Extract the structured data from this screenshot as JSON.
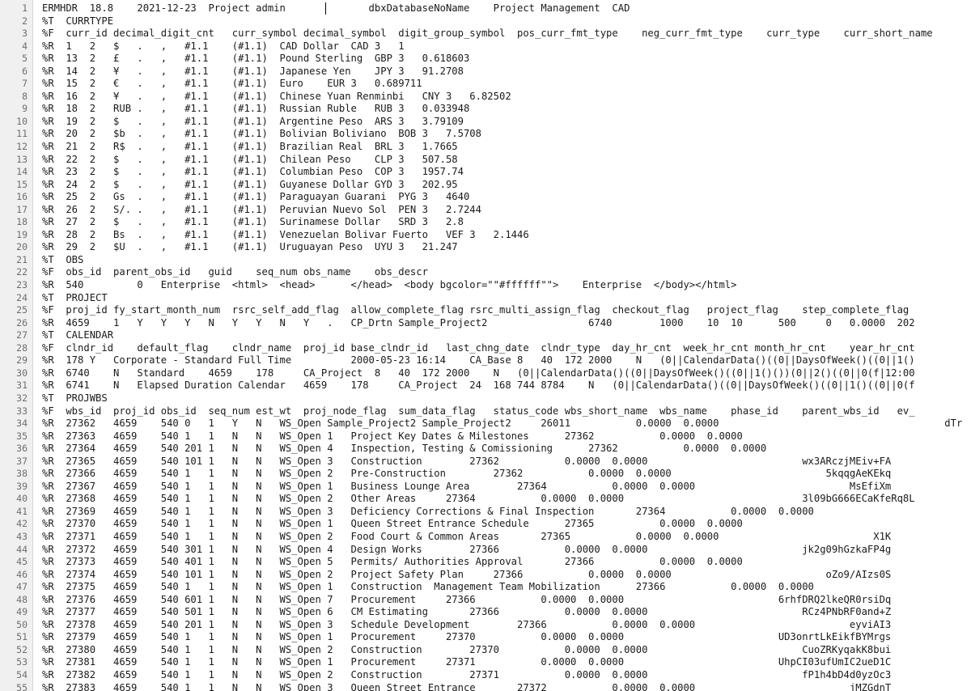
{
  "editor": {
    "lines": [
      "ERMHDR  18.8    2021-12-23  Project admin              dbxDatabaseNoName    Project Management  CAD",
      "%T  CURRTYPE",
      "%F  curr_id decimal_digit_cnt   curr_symbol decimal_symbol  digit_group_symbol  pos_curr_fmt_type    neg_curr_fmt_type    curr_type    curr_short_name",
      "%R  1   2   $   .   ,   #1.1    (#1.1)  CAD Dollar  CAD 3   1",
      "%R  13  2   £   .   ,   #1.1    (#1.1)  Pound Sterling  GBP 3   0.618603",
      "%R  14  2   ¥   .   ,   #1.1    (#1.1)  Japanese Yen    JPY 3   91.2708",
      "%R  15  2   €   .   ,   #1.1    (#1.1)  Euro    EUR 3   0.689711",
      "%R  16  2   ¥   .   ,   #1.1    (#1.1)  Chinese Yuan Renminbi   CNY 3   6.82502",
      "%R  18  2   RUB .   ,   #1.1    (#1.1)  Russian Ruble   RUB 3   0.033948",
      "%R  19  2   $   .   ,   #1.1    (#1.1)  Argentine Peso  ARS 3   3.79109",
      "%R  20  2   $b  .   ,   #1.1    (#1.1)  Bolivian Boliviano  BOB 3   7.5708",
      "%R  21  2   R$  .   ,   #1.1    (#1.1)  Brazilian Real  BRL 3   1.7665",
      "%R  22  2   $   .   ,   #1.1    (#1.1)  Chilean Peso    CLP 3   507.58",
      "%R  23  2   $   .   ,   #1.1    (#1.1)  Columbian Peso  COP 3   1957.74",
      "%R  24  2   $   .   ,   #1.1    (#1.1)  Guyanese Dollar GYD 3   202.95",
      "%R  25  2   Gs  .   ,   #1.1    (#1.1)  Paraguayan Guarani  PYG 3   4640",
      "%R  26  2   S/. .   ,   #1.1    (#1.1)  Peruvian Nuevo Sol  PEN 3   2.7244",
      "%R  27  2   $   .   ,   #1.1    (#1.1)  Surinamese Dollar   SRD 3   2.8",
      "%R  28  2   Bs  .   ,   #1.1    (#1.1)  Venezuelan Bolivar Fuerto   VEF 3   2.1446",
      "%R  29  2   $U  .   ,   #1.1    (#1.1)  Uruguayan Peso  UYU 3   21.247",
      "%T  OBS",
      "%F  obs_id  parent_obs_id   guid    seq_num obs_name    obs_descr",
      "%R  540         0   Enterprise  <html>\u0001\u0001  <head>\u0001\u0001    \u0001\u0001  </head>\u0001\u0001\u0001\u0001  <body bgcolor=\"\"#ffffff\"\">\u0001\u0001    Enterprise\u0001\u0001  </body>\u0001\u0001\u0001\u0001</html>",
      "%T  PROJECT",
      "%F  proj_id fy_start_month_num  rsrc_self_add_flag  allow_complete_flag rsrc_multi_assign_flag  checkout_flag   project_flag    step_complete_flag",
      "%R  4659    1   Y   Y   Y   N   Y   Y   N   Y   .   CP_Drtn Sample_Project2                 6740        1000    10  10      500     0   0.0000  202",
      "%T  CALENDAR",
      "%F  clndr_id    default_flag    clndr_name  proj_id base_clndr_id   last_chng_date  clndr_type  day_hr_cnt  week_hr_cnt month_hr_cnt    year_hr_cnt",
      "%R  178 Y   Corporate - Standard Full Time          2000-05-23 16:14    CA_Base 8   40  172 2000    N   (0||CalendarData()((0||DaysOfWeek()((0||1()",
      "%R  6740    N   Standard    4659    178     CA_Project  8   40  172 2000    N   (0||CalendarData()((0||DaysOfWeek()((0||1()())(0||2()((0||0(f|12:00",
      "%R  6741    N   Elapsed Duration Calendar   4659    178     CA_Project  24  168 744 8784    N   (0||CalendarData()((0||DaysOfWeek()((0||1()((0||0(f",
      "%T  PROJWBS",
      "%F  wbs_id  proj_id obs_id  seq_num est_wt  proj_node_flag  sum_data_flag   status_code wbs_short_name  wbs_name    phase_id    parent_wbs_id   ev_",
      "%R  27362   4659    540 0   1   Y   N   WS_Open Sample_Project2 Sample_Project2     26011           0.0000  0.0000                                      dTr",
      "%R  27363   4659    540 1   1   N   N   WS_Open 1   Project Key Dates & Milestones      27362           0.0000  0.0000",
      "%R  27364   4659    540 201 1   N   N   WS_Open 4   Inspection, Testing & Comissioning      27362           0.0000  0.0000",
      "%R  27365   4659    540 101 1   N   N   WS_Open 3   Construction        27362           0.0000  0.0000                          wx3ARczjMEiv+FA",
      "%R  27366   4659    540 1   1   N   N   WS_Open 2   Pre-Construction        27362           0.0000  0.0000                          5kqqgAeKEkq",
      "%R  27367   4659    540 1   1   N   N   WS_Open 1   Business Lounge Area        27364           0.0000  0.0000                          MsEfiXm",
      "%R  27368   4659    540 1   1   N   N   WS_Open 2   Other Areas     27364           0.0000  0.0000                              3l09bG666ECaKfeRq8L",
      "%R  27369   4659    540 1   1   N   N   WS_Open 3   Deficiency Corrections & Final Inspection       27364           0.0000  0.0000",
      "%R  27370   4659    540 1   1   N   N   WS_Open 1   Queen Street Entrance Schedule      27365           0.0000  0.0000",
      "%R  27371   4659    540 1   1   N   N   WS_Open 2   Food Court & Common Areas       27365           0.0000  0.0000                          X1K",
      "%R  27372   4659    540 301 1   N   N   WS_Open 4   Design Works        27366           0.0000  0.0000                          jk2g09hGzkaFP4g",
      "%R  27373   4659    540 401 1   N   N   WS_Open 5   Permits/ Authorities Approval       27366           0.0000  0.0000",
      "%R  27374   4659    540 101 1   N   N   WS_Open 2   Project Safety Plan     27366           0.0000  0.0000                          oZo9/AIzs0S",
      "%R  27375   4659    540 1   1   N   N   WS_Open 1   Construction  Management Team Mobilization      27366           0.0000  0.0000",
      "%R  27376   4659    540 601 1   N   N   WS_Open 7   Procurement     27366           0.0000  0.0000                          6rhfDRQ2lkeQR0rsiDq",
      "%R  27377   4659    540 501 1   N   N   WS_Open 6   CM Estimating       27366           0.0000  0.0000                          RCz4PNbRF0and+Z",
      "%R  27378   4659    540 201 1   N   N   WS_Open 3   Schedule Development        27366           0.0000  0.0000                          eyviAI3",
      "%R  27379   4659    540 1   1   N   N   WS_Open 1   Procurement     27370           0.0000  0.0000                          UD3onrtLkEikfBYMrgs",
      "%R  27380   4659    540 1   1   N   N   WS_Open 2   Construction        27370           0.0000  0.0000                          CuoZRKyqakK8bui",
      "%R  27381   4659    540 1   1   N   N   WS_Open 1   Procurement     27371           0.0000  0.0000                          UhpCI03ufUmIC2ueD1C",
      "%R  27382   4659    540 1   1   N   N   WS_Open 2   Construction        27371           0.0000  0.0000                          fP1h4bD4d0yzOc3",
      "%R  27383   4659    540 1   1   N   N   WS_Open 3   Queen Street Entrance       27372           0.0000  0.0000                          jMZGdnT"
    ]
  }
}
